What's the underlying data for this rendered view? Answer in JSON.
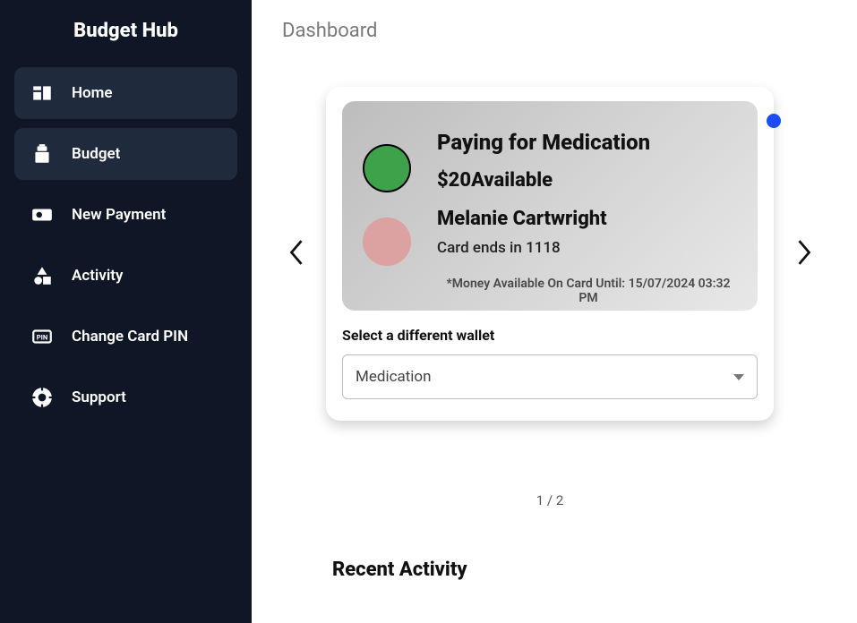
{
  "app_title": "Budget Hub",
  "page_title": "Dashboard",
  "nav": {
    "home": "Home",
    "budget": "Budget",
    "new_payment": "New Payment",
    "activity": "Activity",
    "change_pin": "Change Card PIN",
    "support": "Support"
  },
  "wallet_card": {
    "title": "Paying for Medication",
    "balance_amount": "$20",
    "balance_status": "Available",
    "owner_name": "Melanie Cartwright",
    "card_ends_prefix": "Card ends in ",
    "card_last4": "1118",
    "footnote": "*Money Available On Card Until: 15/07/2024 03:32 PM"
  },
  "wallet_select": {
    "label": "Select a different wallet",
    "value": "Medication"
  },
  "pagination": {
    "current": "1",
    "sep": " / ",
    "total": "2"
  },
  "recent_activity_heading": "Recent Activity"
}
